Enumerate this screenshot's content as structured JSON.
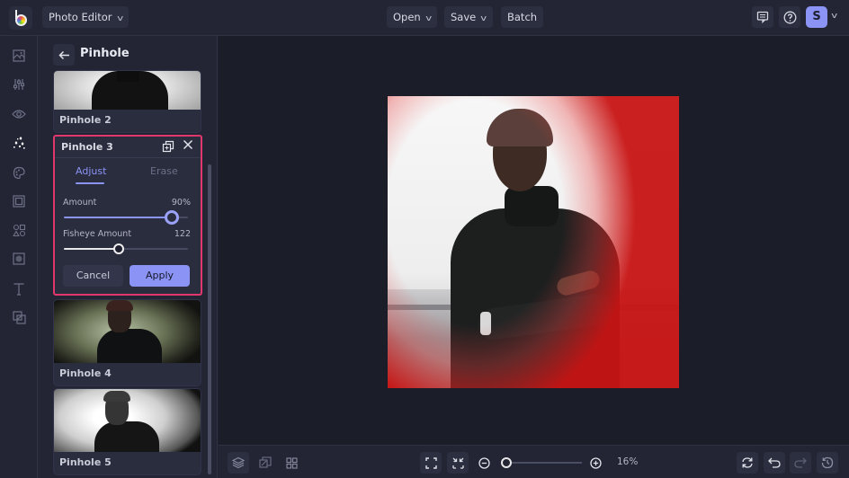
{
  "topbar": {
    "app_menu_label": "Photo Editor",
    "open_label": "Open",
    "save_label": "Save",
    "batch_label": "Batch",
    "avatar_initial": "S"
  },
  "rail": {
    "items": [
      {
        "icon": "image-icon",
        "active": false
      },
      {
        "icon": "adjust-sliders-icon",
        "active": false
      },
      {
        "icon": "eye-icon",
        "active": false
      },
      {
        "icon": "effects-sparkle-icon",
        "active": true
      },
      {
        "icon": "palette-icon",
        "active": false
      },
      {
        "icon": "frame-icon",
        "active": false
      },
      {
        "icon": "shapes-icon",
        "active": false
      },
      {
        "icon": "texture-icon",
        "active": false
      },
      {
        "icon": "text-icon",
        "active": false
      },
      {
        "icon": "overlay-icon",
        "active": false
      }
    ]
  },
  "panel": {
    "title": "Pinhole",
    "cards": [
      {
        "label": "Pinhole 2"
      },
      {
        "label": "Pinhole 4"
      },
      {
        "label": "Pinhole 5"
      }
    ],
    "editor": {
      "title": "Pinhole 3",
      "tabs": [
        {
          "label": "Adjust",
          "active": true
        },
        {
          "label": "Erase",
          "active": false
        }
      ],
      "sliders": [
        {
          "label": "Amount",
          "value_text": "90%",
          "fraction": 0.87
        },
        {
          "label": "Fisheye Amount",
          "value_text": "122",
          "fraction": 0.44
        }
      ],
      "cancel_label": "Cancel",
      "apply_label": "Apply"
    }
  },
  "bottombar": {
    "zoom_text": "16%",
    "zoom_fraction": 0.02
  },
  "colors": {
    "accent": "#8b93f5",
    "highlight_border": "#e0386c",
    "background": "#1f2130"
  }
}
